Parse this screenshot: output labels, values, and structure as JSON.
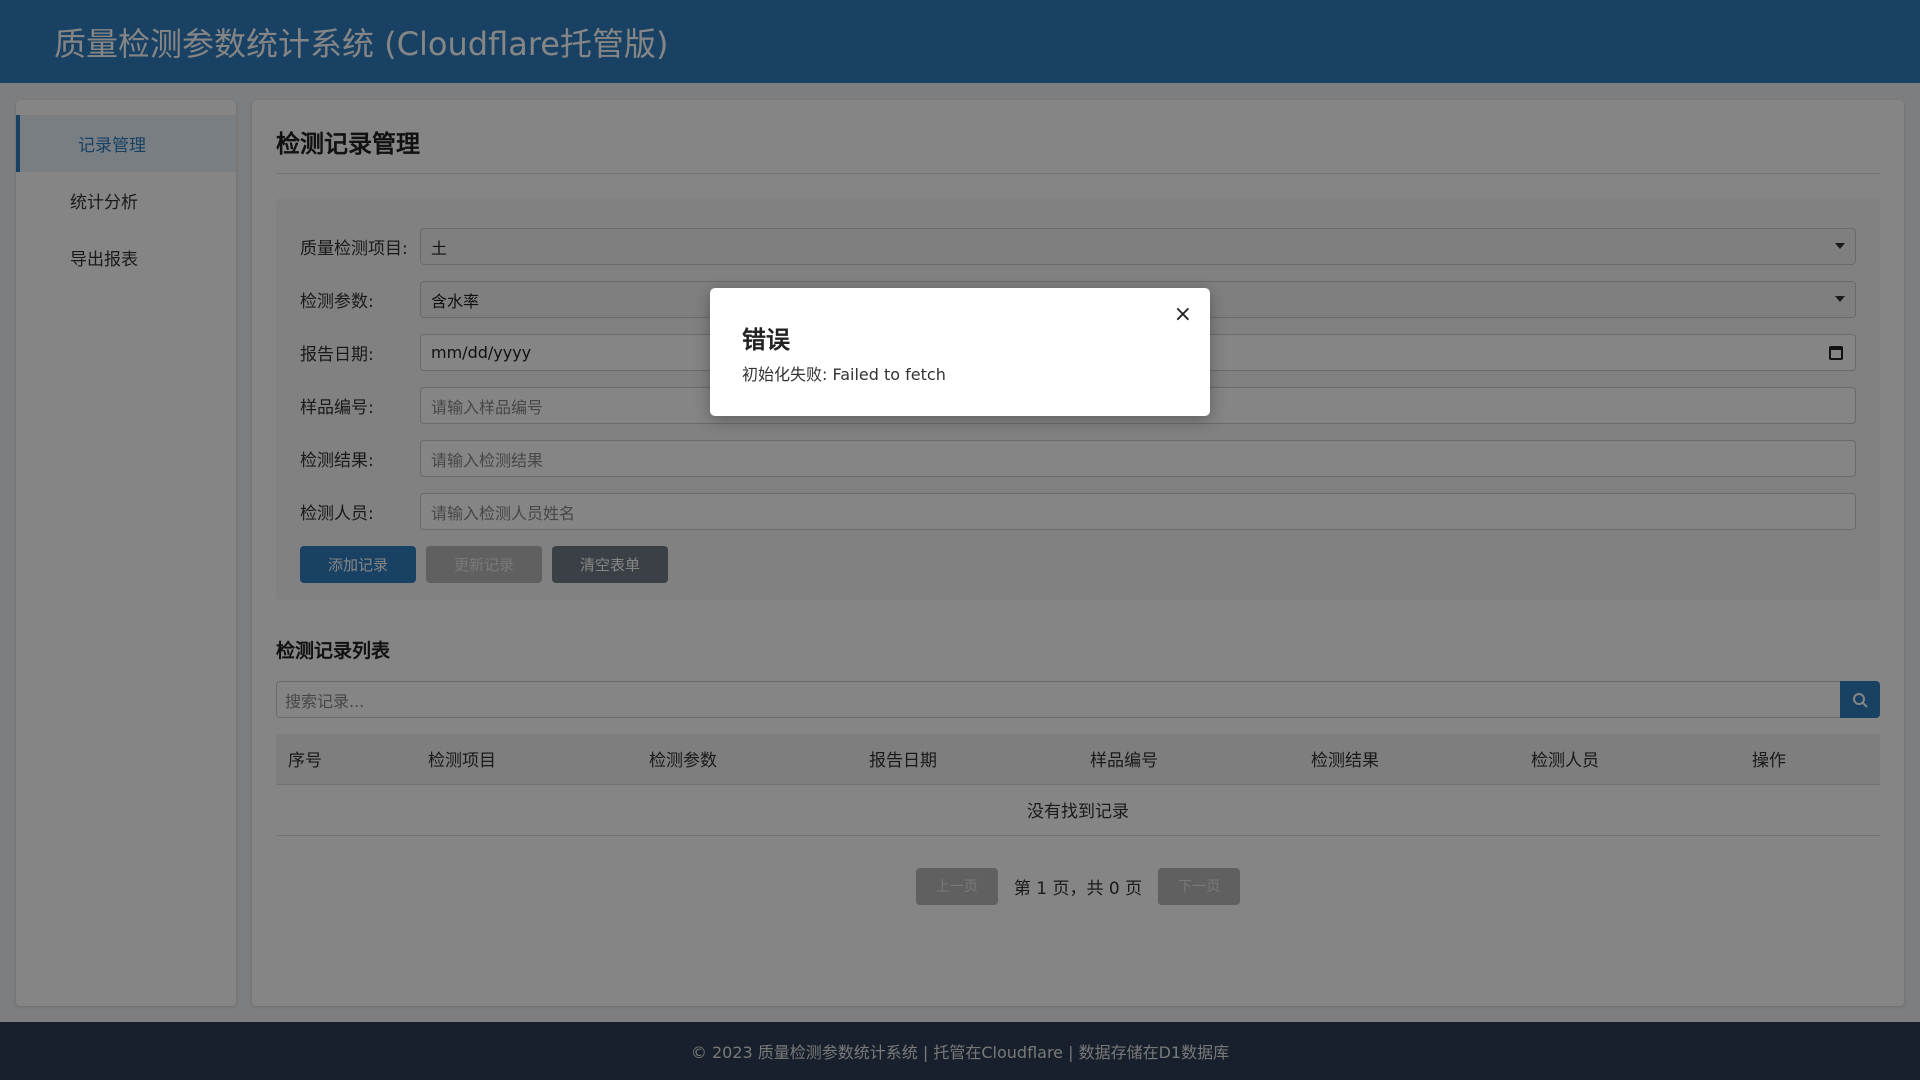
{
  "header": {
    "title": "质量检测参数统计系统 (Cloudflare托管版)"
  },
  "sidebar": {
    "items": [
      {
        "label": "记录管理"
      },
      {
        "label": "统计分析"
      },
      {
        "label": "导出报表"
      }
    ]
  },
  "main": {
    "title": "检测记录管理",
    "form": {
      "project_label": "质量检测项目:",
      "project_value": "土",
      "param_label": "检测参数:",
      "param_value": "含水率",
      "date_label": "报告日期:",
      "date_value": "mm/dd/yyyy",
      "sample_label": "样品编号:",
      "sample_placeholder": "请输入样品编号",
      "result_label": "检测结果:",
      "result_placeholder": "请输入检测结果",
      "person_label": "检测人员:",
      "person_placeholder": "请输入检测人员姓名",
      "add_button": "添加记录",
      "update_button": "更新记录",
      "clear_button": "清空表单"
    },
    "list": {
      "title": "检测记录列表",
      "search_placeholder": "搜索记录...",
      "columns": [
        "序号",
        "检测项目",
        "检测参数",
        "报告日期",
        "样品编号",
        "检测结果",
        "检测人员",
        "操作"
      ],
      "empty_text": "没有找到记录"
    },
    "pager": {
      "prev": "上一页",
      "info": "第 1 页，共 0 页",
      "next": "下一页"
    }
  },
  "footer": {
    "text": "© 2023 质量检测参数统计系统 | 托管在Cloudflare | 数据存储在D1数据库"
  },
  "modal": {
    "title": "错误",
    "message": "初始化失败: Failed to fetch",
    "close_glyph": "×"
  },
  "colors": {
    "accent": "#2f7dbf",
    "footer": "#2c3e55"
  }
}
